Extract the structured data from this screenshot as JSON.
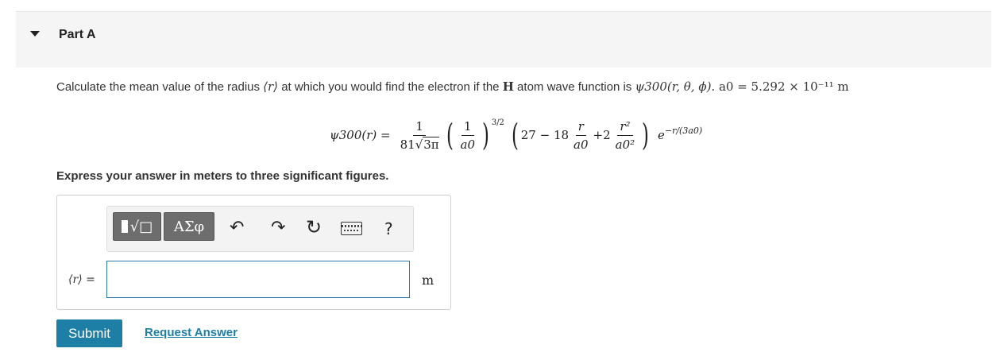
{
  "part": {
    "title": "Part A"
  },
  "question": {
    "lead": "Calculate the mean value of the radius ",
    "r_sym": "⟨r⟩",
    "mid": " at which you would find the electron if the ",
    "H": "H",
    "tail": " atom wave function is ",
    "psi_label": "ψ300(r, θ, ϕ)",
    "a0_text": ". a0 = 5.292 × 10⁻¹¹ m"
  },
  "formula": {
    "lhs": "ψ300(r) =",
    "frac1_num": "1",
    "frac1_den_pre": "81",
    "frac1_den_sqrt": "3π",
    "frac2_num": "1",
    "frac2_den": "a0",
    "power": "3/2",
    "poly_a": "27 − 18",
    "frac3_num": "r",
    "frac3_den": "a0",
    "poly_b": "+2",
    "frac4_num": "r²",
    "frac4_den": "a0²",
    "exp_base": "e",
    "exp_power": "−r/(3a0)"
  },
  "instruction": "Express your answer in meters to three significant figures.",
  "toolbar": {
    "template_label": "√□",
    "greek_label": "ΑΣφ",
    "undo_icon": "undo-icon",
    "redo_icon": "redo-icon",
    "reset_icon": "reset-icon",
    "keyboard_icon": "keyboard-icon",
    "help_label": "?"
  },
  "answer": {
    "label": "⟨r⟩ =",
    "value": "",
    "unit": "m"
  },
  "buttons": {
    "submit": "Submit",
    "request": "Request Answer"
  },
  "colors": {
    "accent": "#1d7fa6",
    "header_bg": "#f5f5f5",
    "toolbar_dark": "#6d6d6d"
  }
}
